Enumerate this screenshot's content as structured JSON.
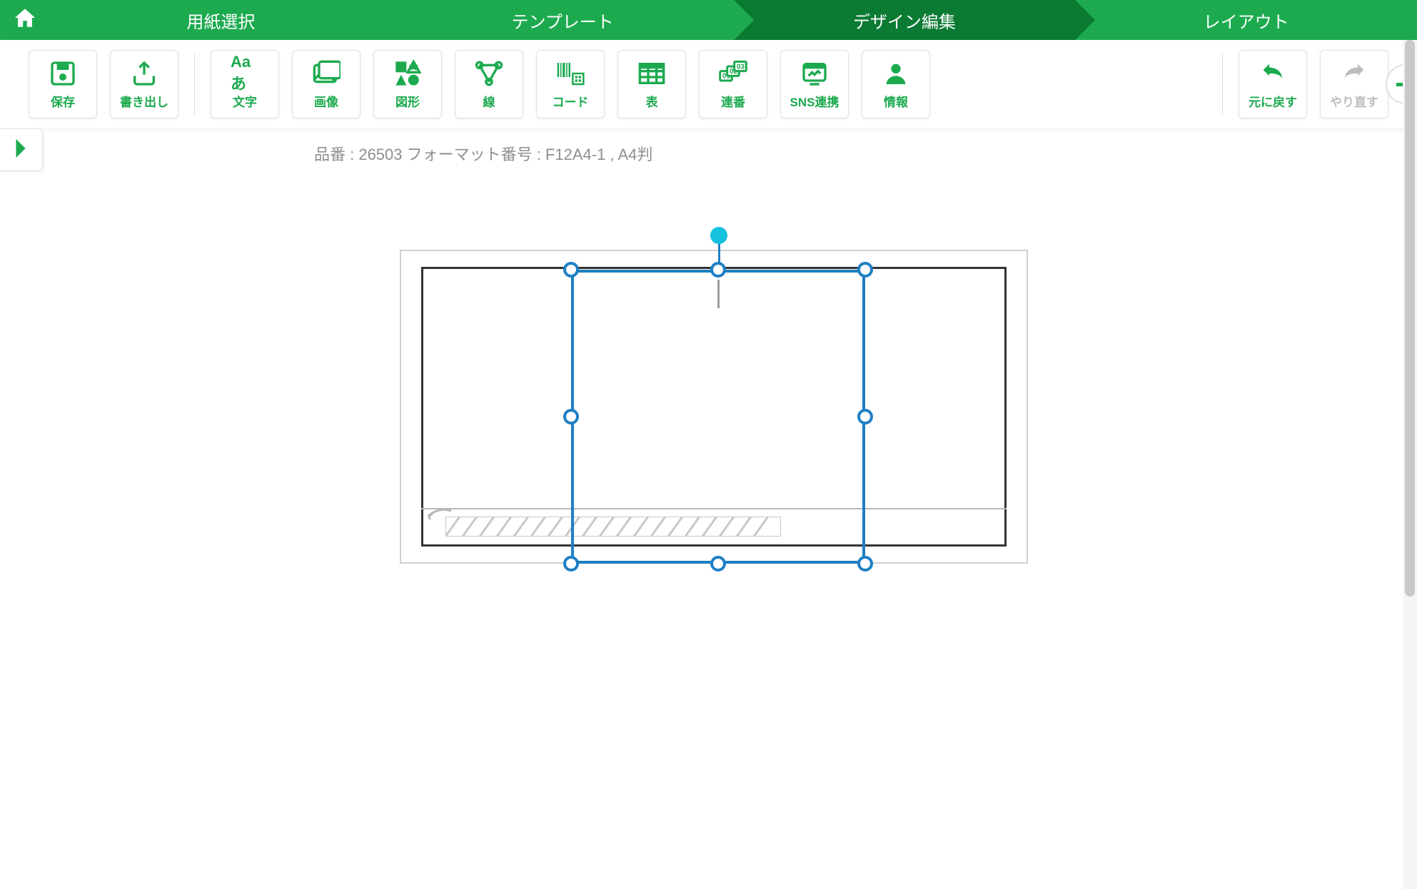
{
  "steps": {
    "paper": "用紙選択",
    "template": "テンプレート",
    "design": "デザイン編集",
    "layout": "レイアウト"
  },
  "toolbar": {
    "save": "保存",
    "export": "書き出し",
    "text": "文字",
    "text_icon": "Aaあ",
    "image": "画像",
    "shape": "図形",
    "line": "線",
    "code": "コード",
    "table": "表",
    "serial": "連番",
    "sns": "SNS連携",
    "info": "情報",
    "undo": "元に戻す",
    "redo": "やり直す"
  },
  "info": {
    "text": "品番 : 26503 フォーマット番号 : F12A4-1 , A4判"
  }
}
